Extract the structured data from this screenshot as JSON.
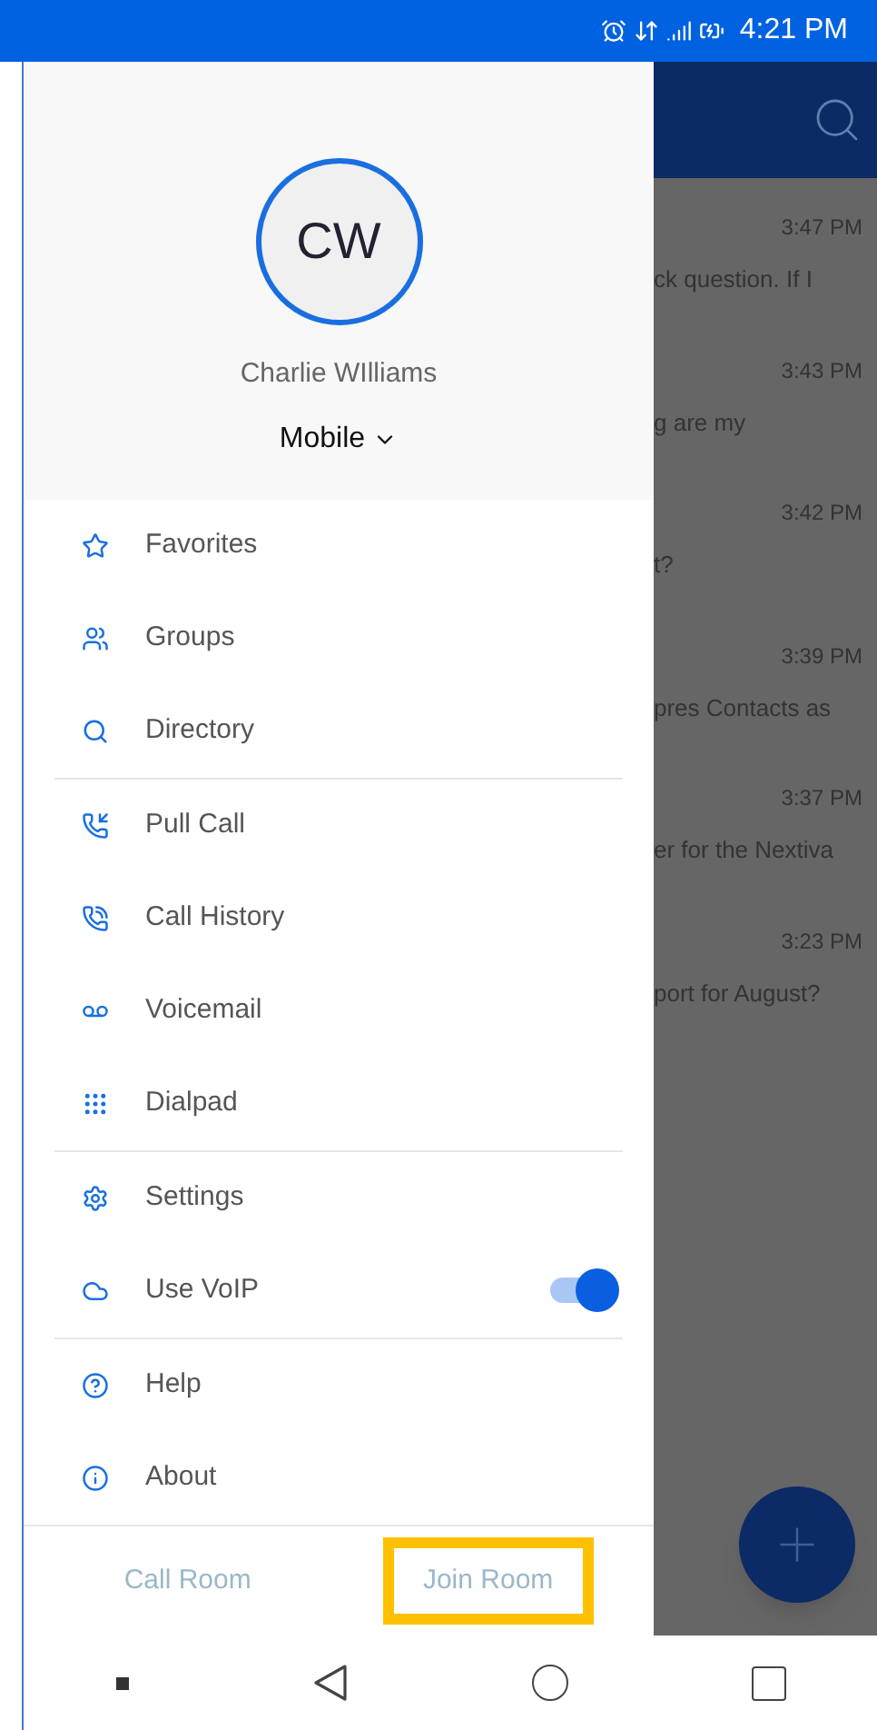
{
  "status_bar": {
    "time": "4:21 PM"
  },
  "profile": {
    "initials": "CW",
    "name": "Charlie WIlliams",
    "device": "Mobile"
  },
  "menu_sections": [
    {
      "items": [
        {
          "kind": "link",
          "label": "Favorites"
        },
        {
          "kind": "link",
          "label": "Groups"
        },
        {
          "kind": "link",
          "label": "Directory"
        }
      ]
    },
    {
      "items": [
        {
          "kind": "link",
          "label": "Pull Call"
        },
        {
          "kind": "link",
          "label": "Call History"
        },
        {
          "kind": "link",
          "label": "Voicemail"
        },
        {
          "kind": "link",
          "label": "Dialpad"
        }
      ]
    },
    {
      "items": [
        {
          "kind": "link",
          "label": "Settings"
        },
        {
          "kind": "toggle",
          "label": "Use VoIP",
          "on": true
        }
      ]
    },
    {
      "items": [
        {
          "kind": "link",
          "label": "Help"
        },
        {
          "kind": "link",
          "label": "About"
        }
      ]
    }
  ],
  "footer_buttons": [
    {
      "label": "Call Room",
      "highlighted": false
    },
    {
      "label": "Join Room",
      "highlighted": true
    }
  ],
  "messages": [
    {
      "time": "3:47 PM",
      "preview": "ck question. If I"
    },
    {
      "time": "3:43 PM",
      "preview": "g are my"
    },
    {
      "time": "3:42 PM",
      "preview": "t?"
    },
    {
      "time": "3:39 PM",
      "preview": "pres Contacts as"
    },
    {
      "time": "3:37 PM",
      "preview": "er for the Nextiva"
    },
    {
      "time": "3:23 PM",
      "preview": "port for August?"
    }
  ]
}
